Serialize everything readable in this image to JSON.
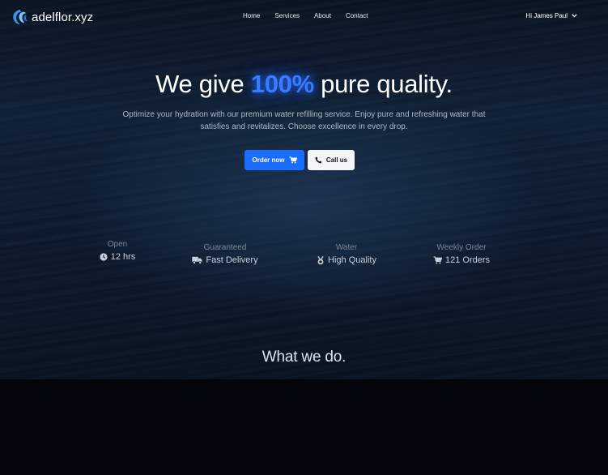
{
  "brand": {
    "name": "adelflor.xyz",
    "logo_icon": "wave-logo-icon",
    "logo_color": "#4fa3ff"
  },
  "nav": {
    "links": [
      "Home",
      "Services",
      "About",
      "Contact"
    ],
    "user_greeting": "Hi James Paul"
  },
  "hero": {
    "headline_before": "We give ",
    "headline_accent": "100%",
    "headline_after": " pure quality.",
    "accent_color": "#3a7bff",
    "subtitle": "Optimize your hydration with our premium water refilling service. Enjoy pure and refreshing water that satisfies and revitalizes. Choose excellence in every drop.",
    "order_button": {
      "label": "Order now",
      "icon": "cart-icon",
      "color": "#1a6dff"
    },
    "call_button": {
      "label": "Call us",
      "icon": "phone-icon"
    }
  },
  "stats": [
    {
      "label": "Open",
      "value": "12 hrs",
      "icon": "clock-icon"
    },
    {
      "label": "Guaranteed",
      "value": "Fast Delivery",
      "icon": "truck-icon"
    },
    {
      "label": "Water",
      "value": "High Quality",
      "icon": "medal-icon"
    },
    {
      "label": "Weekly Order",
      "value": "121 Orders",
      "icon": "cart-icon"
    }
  ],
  "section": {
    "title": "What we do."
  }
}
